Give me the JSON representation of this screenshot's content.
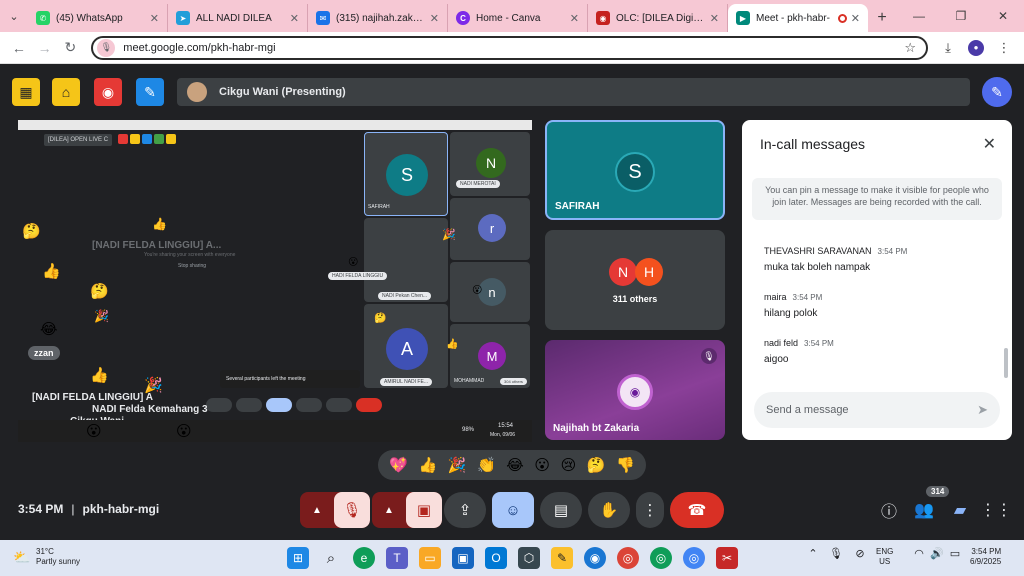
{
  "browser": {
    "tabs": [
      {
        "title": "(45) WhatsApp",
        "color": "#25d366",
        "glyph": "✆"
      },
      {
        "title": "ALL NADI DILEA",
        "color": "#229ed9",
        "glyph": "➤"
      },
      {
        "title": "(315) najihah.zakaria@",
        "color": "#1a73e8",
        "glyph": "✉"
      },
      {
        "title": "Home - Canva",
        "color": "#7d2ae8",
        "glyph": "C"
      },
      {
        "title": "OLC: [DILEA Digital Le",
        "color": "#c5221f",
        "glyph": "◉"
      },
      {
        "title": "Meet - pkh-habr-",
        "color": "#00897b",
        "glyph": "▶"
      }
    ],
    "url": "meet.google.com/pkh-habr-mgi"
  },
  "meet": {
    "presenting_label": "Cikgu Wani (Presenting)",
    "shared_screen": {
      "chip": "[DILEA] OPEN LIVE C",
      "ghost_title": "[NADI FELDA LINGGIU] A...",
      "ghost_sub": "You're sharing your screen with everyone",
      "stop_sharing": "Stop sharing",
      "tile_safirah": "SAFIRAH",
      "tile_nadi_merotai": "NADI MEROTAI",
      "tile_hadi_felda": "HADI FELDA LINGGIU",
      "tile_nadi_pekan": "NADI Pekan Chen...",
      "tile_amirul": "AMIRUL NADI FE...",
      "tile_mohammad": "MOHAMMAD",
      "tile_others": "304 others",
      "toast": "Several participants left the meeting",
      "caption_1": "[NADI FELDA LINGGIU] A",
      "caption_2": "NADI Felda Kemahang 3",
      "caption_3": "Cikgu Wani",
      "pill": "zzan",
      "battery": "98%",
      "screen_time": "15:54",
      "screen_date": "Mon, 09/06"
    },
    "tiles": {
      "safirah": "SAFIRAH",
      "others": "311 others",
      "najihah": "Najihah bt Zakaria"
    },
    "chat": {
      "title": "In-call messages",
      "info": "You can pin a message to make it visible for people who join later. Messages are being recorded with the call.",
      "messages": [
        {
          "sender": "THEVASHRI SARAVANAN",
          "time": "3:54 PM",
          "text": "muka tak boleh nampak"
        },
        {
          "sender": "maira",
          "time": "3:54 PM",
          "text": "hilang polok"
        },
        {
          "sender": "nadi feld",
          "time": "3:54 PM",
          "text": "aigoo"
        }
      ],
      "input_placeholder": "Send a message"
    },
    "reactions": [
      "💖",
      "👍",
      "🎉",
      "👏",
      "😂",
      "😮",
      "😢",
      "🤔",
      "👎"
    ],
    "meeting_time": "3:54 PM",
    "meeting_code": "pkh-habr-mgi",
    "participant_count": "314"
  },
  "taskbar": {
    "weather_temp": "31°C",
    "weather_desc": "Partly sunny",
    "lang_1": "ENG",
    "lang_2": "US",
    "time": "3:54 PM",
    "date": "6/9/2025"
  }
}
